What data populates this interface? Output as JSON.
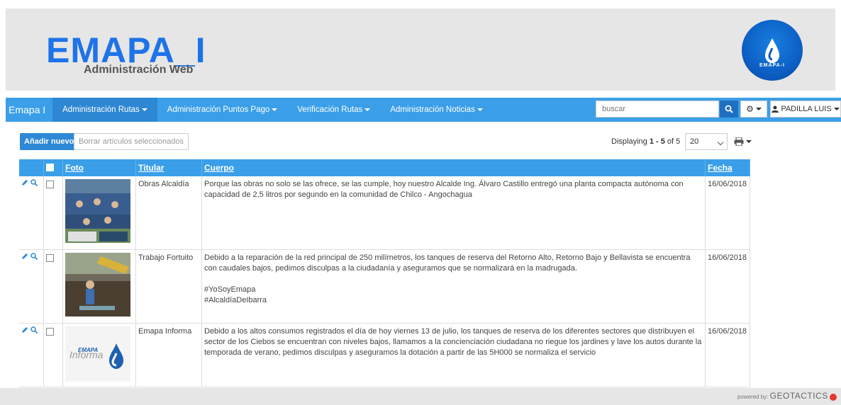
{
  "header": {
    "brand": "EMAPA_I",
    "subtitle": "Administración Web",
    "logo_text": "EMAPA-I"
  },
  "navbar": {
    "brand": "Emapa I",
    "items": [
      {
        "label": "Administración Rutas",
        "active": true
      },
      {
        "label": "Administración Puntos Pago",
        "active": false
      },
      {
        "label": "Verificación Rutas",
        "active": false
      },
      {
        "label": "Administración Noticias",
        "active": false
      }
    ],
    "search_placeholder": "buscar",
    "user": "PADILLA LUIS"
  },
  "toolbar": {
    "add_label": "Añadir nuevo",
    "delete_label": "Borrar artículos seleccionados",
    "displaying_prefix": "Displaying ",
    "displaying_range": "1 - 5",
    "displaying_suffix": " of 5",
    "per_page": "20"
  },
  "table": {
    "columns": {
      "photo": "Foto",
      "title": "Titular",
      "body": "Cuerpo",
      "date": "Fecha"
    },
    "rows": [
      {
        "title": "Obras Alcaldía",
        "body": "Porque las obras no solo se las ofrece, se las cumple, hoy nuestro Alcalde Ing. Álvaro Castillo entregó una planta compacta autónoma con capacidad de 2,5 litros por segundo en la comunidad de Chilco - Angochagua",
        "date": "16/06/2018",
        "photo": "group-photo-icon"
      },
      {
        "title": "Trabajo Fortuito",
        "body": "Debido a la reparación de la red principal de 250 milímetros, los tanques de reserva del Retorno Alto, Retorno Bajo y Bellavista se encuentra con caudales bajos, pedimos disculpas a la ciudadanía y aseguramos que se normalizará en la madrugada.\n\n#YoSoyEmapa\n#AlcaldíaDeIbarra",
        "date": "16/06/2018",
        "photo": "excavation-photo-icon"
      },
      {
        "title": "Emapa Informa",
        "body": "Debido a los altos consumos registrados el día de hoy viernes 13 de julio, los tanques de reserva de los diferentes sectores que distribuyen el sector de los Ciebos se encuentran con niveles bajos, llamamos a la concienciación ciudadana no riegue los jardines y lave los autos durante la temporada de verano, pedimos disculpas y aseguramos la dotación a partir de las 5H000 se normaliza el servicio",
        "date": "16/06/2018",
        "photo": "emapa-informa-logo",
        "photo_text_top": "EMAPA",
        "photo_text_bottom": "Informa"
      }
    ]
  },
  "footer": {
    "powered_by": "powered by:",
    "company": "GEOTACTICS"
  },
  "colors": {
    "brand_blue": "#1e73e8",
    "navbar": "#3a9fe8",
    "header_bg": "#e6e6e6"
  }
}
